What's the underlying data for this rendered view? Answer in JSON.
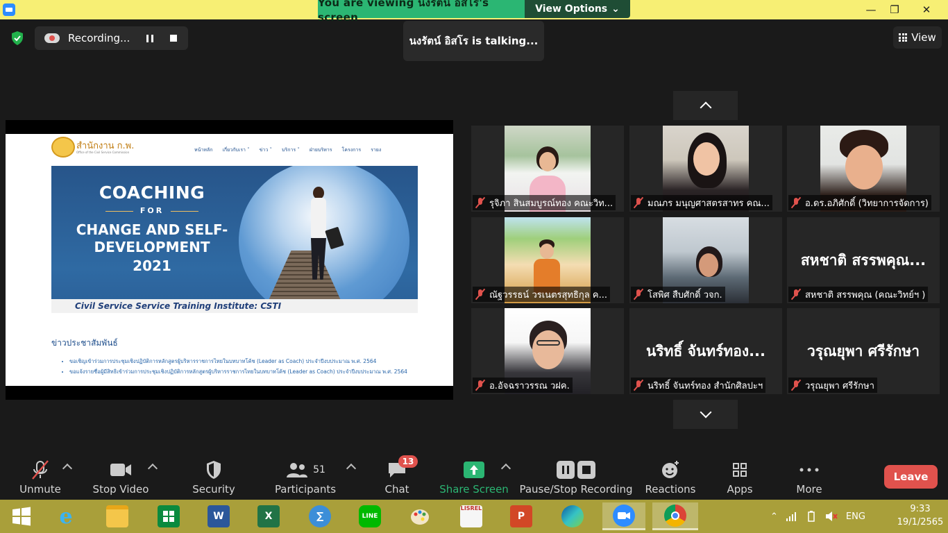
{
  "share_bar": {
    "viewing_text": "You are viewing นงรัตน์ อิสโร's screen",
    "view_options": "View Options",
    "window_controls": [
      "—",
      "❐",
      "✕"
    ]
  },
  "meeting": {
    "recording_label": "Recording...",
    "talking_text": "นงรัตน์ อิสโร is talking...",
    "view_label": "View"
  },
  "shared_page": {
    "site_name": "สำนักงาน ก.พ.",
    "site_sub": "Office of the Civil Service Commission",
    "nav": [
      "หน้าหลัก",
      "เกี่ยวกับเรา ˅",
      "ข่าว ˅",
      "บริการ ˅",
      "ฝ่ายบริหาร",
      "โครงการ",
      "รายง"
    ],
    "hero_line1": "COACHING",
    "hero_for": "FOR",
    "hero_line2": "CHANGE AND SELF-DEVELOPMENT",
    "hero_year": "2021",
    "hero_footer": "Civil Service Service Training Institute: CSTI",
    "news_title": "ข่าวประชาสัมพันธ์",
    "news_items": [
      "ขอเชิญเข้าร่วมการประชุมเชิงปฏิบัติการหลักสูตรผู้บริหารราชการไทยในบทบาทโค้ช (Leader as Coach) ประจำปีงบประมาณ พ.ศ. 2564",
      "ขอแจ้งรายชื่อผู้มีสิทธิเข้าร่วมการประชุมเชิงปฏิบัติการหลักสูตรผู้บริหารราชการไทยในบทบาทโค้ช (Leader as Coach) ประจำปีงบประมาณ พ.ศ. 2564"
    ]
  },
  "participants": [
    {
      "name": "รุจิภา สินสมบูรณ์ทอง คณะวิท...",
      "video": true,
      "style": "p1"
    },
    {
      "name": "มณภร มนุญศาสตรสาทร คณ...",
      "video": true,
      "style": "p2"
    },
    {
      "name": "อ.ดร.อภิศักดิ์ (วิทยาการจัดการ)",
      "video": true,
      "style": "p3"
    },
    {
      "name": "ณัฐวรรธน์ วรเนตรสุทธิกุล ค...",
      "video": true,
      "style": "p4"
    },
    {
      "name": "โสพิศ สืบศักดิ์ วจก.",
      "video": true,
      "style": "p5"
    },
    {
      "name": "สหชาติ สรรพคุณ (คณะวิทย์ฯ )",
      "video": false,
      "display": "สหชาติ สรรพคุณ..."
    },
    {
      "name": "อ.อัจฉราวรรณ วฝค.",
      "video": true,
      "style": "p6"
    },
    {
      "name": "นริทธิ์ จันทร์ทอง สำนักศิลปะฯ",
      "video": false,
      "display": "นริทธิ์ จันทร์ทอง..."
    },
    {
      "name": "วรุณยุพา ศรีรักษา",
      "video": false,
      "display": "วรุณยุพา ศรีรักษา"
    }
  ],
  "toolbar": {
    "unmute": "Unmute",
    "stop_video": "Stop Video",
    "security": "Security",
    "participants": "Participants",
    "participants_count": "51",
    "chat": "Chat",
    "chat_badge": "13",
    "share_screen": "Share Screen",
    "pause_stop_recording": "Pause/Stop Recording",
    "reactions": "Reactions",
    "apps": "Apps",
    "more": "More",
    "leave": "Leave"
  },
  "colors": {
    "share_green": "#2bb673",
    "leave_red": "#e0524d",
    "taskbar": "#a99f3a"
  },
  "taskbar": {
    "apps": [
      {
        "name": "windows-start-icon"
      },
      {
        "name": "internet-explorer-icon"
      },
      {
        "name": "file-explorer-icon"
      },
      {
        "name": "microsoft-store-icon"
      },
      {
        "name": "word-icon",
        "text": "W"
      },
      {
        "name": "excel-icon",
        "text": "X"
      },
      {
        "name": "calculator-icon",
        "text": "∑"
      },
      {
        "name": "line-icon",
        "text": "LINE"
      },
      {
        "name": "paint-icon"
      },
      {
        "name": "lisrel-icon",
        "text": "LISREL"
      },
      {
        "name": "powerpoint-icon",
        "text": "P"
      },
      {
        "name": "edge-icon"
      },
      {
        "name": "zoom-icon"
      },
      {
        "name": "chrome-icon"
      }
    ],
    "language": "ENG",
    "time": "9:33",
    "date": "19/1/2565"
  }
}
